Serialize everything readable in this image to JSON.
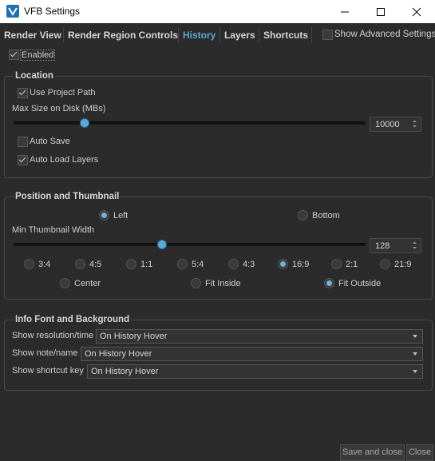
{
  "window": {
    "title": "VFB Settings"
  },
  "tabs": [
    {
      "label": "Render View"
    },
    {
      "label": "Render Region Controls"
    },
    {
      "label": "History",
      "active": true
    },
    {
      "label": "Layers"
    },
    {
      "label": "Shortcuts"
    }
  ],
  "show_advanced": {
    "label": "Show Advanced Settings",
    "checked": false
  },
  "enabled": {
    "label": "Enabled",
    "checked": true
  },
  "location": {
    "title": "Location",
    "use_project_path": {
      "label": "Use Project Path",
      "checked": true
    },
    "max_size_label": "Max Size on Disk (MBs)",
    "max_size_value": "10000",
    "max_size_fraction": 0.2,
    "auto_save": {
      "label": "Auto Save",
      "checked": false
    },
    "auto_load_layers": {
      "label": "Auto Load Layers",
      "checked": true
    }
  },
  "position": {
    "title": "Position and Thumbnail",
    "left_label": "Left",
    "bottom_label": "Bottom",
    "selected_side": "Left",
    "min_width_label": "Min Thumbnail Width",
    "min_width_value": "128",
    "min_width_fraction": 0.42,
    "ratios": [
      "3:4",
      "4:5",
      "1:1",
      "5:4",
      "4:3",
      "16:9",
      "2:1",
      "21:9"
    ],
    "selected_ratio": "16:9",
    "fit_modes": [
      "Center",
      "Fit Inside",
      "Fit Outside"
    ],
    "selected_fit": "Fit Outside"
  },
  "info": {
    "title": "Info Font and Background",
    "rows": [
      {
        "label": "Show resolution/time",
        "value": "On History Hover"
      },
      {
        "label": "Show note/name",
        "value": "On History Hover"
      },
      {
        "label": "Show shortcut key",
        "value": "On History Hover"
      }
    ]
  },
  "buttons": {
    "save_close": "Save and close",
    "close": "Close"
  },
  "colors": {
    "accent": "#5aa9d6",
    "background": "#2b2b2b"
  }
}
